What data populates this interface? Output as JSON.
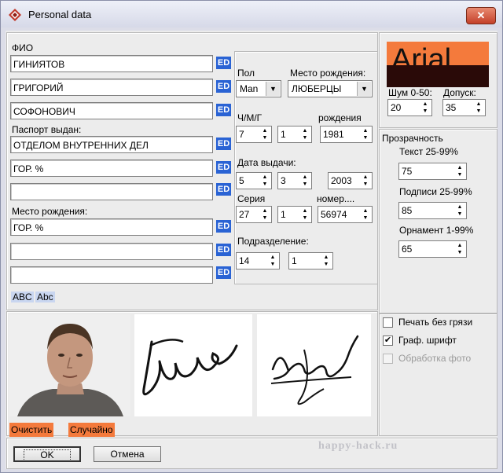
{
  "window": {
    "title": "Personal data",
    "close_label": "✕"
  },
  "fio": {
    "label": "ФИО",
    "surname": "ГИНИЯТОВ",
    "name": "ГРИГОРИЙ",
    "patronymic": "СОФОНОВИЧ",
    "issued_label": "Паспорт выдан:",
    "issued_line1": "ОТДЕЛОМ ВНУТРЕННИХ ДЕЛ",
    "issued_line2": "ГОР. %",
    "issued_line3": "",
    "birthplace_label": "Место рождения:",
    "birthplace_line1": "ГОР. %",
    "birthplace_line2": "",
    "birthplace_line3": "",
    "ed_label": "ED",
    "case_upper": "ABC",
    "case_mixed": "Abc"
  },
  "details": {
    "sex_label": "Пол",
    "sex_value": "Man",
    "birth_city_label": "Место рождения:",
    "birth_city_value": "ЛЮБЕРЦЫ",
    "dmy_label": "Ч/М/Г",
    "birth_label": "рождения",
    "birth_day": "7",
    "birth_month": "1",
    "birth_year": "1981",
    "issue_date_label": "Дата выдачи:",
    "issue_day": "5",
    "issue_month": "3",
    "issue_year": "2003",
    "series_label": "Серия",
    "number_label": "номер....",
    "series_a": "27",
    "series_b": "1",
    "number": "56974",
    "subdivision_label": "Подразделение:",
    "subdivision_a": "14",
    "subdivision_b": "1"
  },
  "font": {
    "preview_text": "Arial",
    "accent_color": "#f47a3c",
    "noise_label": "Шум 0-50:",
    "tolerance_label": "Допуск:",
    "noise_value": "20",
    "tolerance_value": "35"
  },
  "transparency": {
    "title": "Прозрачность",
    "text_label": "Текст 25-99%",
    "text_value": "75",
    "signatures_label": "Подписи 25-99%",
    "signatures_value": "85",
    "ornament_label": "Орнамент 1-99%",
    "ornament_value": "65"
  },
  "options": {
    "print_clean": {
      "label": "Печать без грязи",
      "checked": false
    },
    "graph_font": {
      "label": "Граф. шрифт",
      "checked": true,
      "mark": "✔"
    },
    "photo_processing": {
      "label": "Обработка фото",
      "checked": false,
      "disabled": true
    }
  },
  "actions": {
    "clear": "Очистить",
    "random": "Случайно",
    "ok": "OK",
    "cancel": "Отмена"
  },
  "watermark": "happy-hack.ru"
}
